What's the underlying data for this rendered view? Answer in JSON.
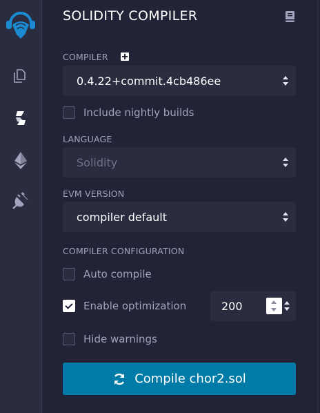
{
  "panel": {
    "title": "SOLIDITY COMPILER"
  },
  "compiler": {
    "label": "COMPILER",
    "selected_version": "0.4.22+commit.4cb486ee",
    "nightly_label": "Include nightly builds",
    "nightly_checked": false
  },
  "language": {
    "label": "LANGUAGE",
    "selected": "Solidity",
    "disabled": true
  },
  "evm": {
    "label": "EVM VERSION",
    "selected": "compiler default"
  },
  "config": {
    "label": "COMPILER CONFIGURATION",
    "auto_compile": {
      "label": "Auto compile",
      "checked": false
    },
    "enable_optimization": {
      "label": "Enable optimization",
      "checked": true,
      "runs": "200"
    },
    "hide_warnings": {
      "label": "Hide warnings",
      "checked": false
    }
  },
  "compile_button": {
    "label": "Compile chor2.sol"
  },
  "iconbar": {
    "items": [
      "remix-logo",
      "file-explorer-icon",
      "solidity-compiler-icon",
      "deploy-run-icon",
      "plugin-manager-icon"
    ],
    "accent": "#007aa6"
  }
}
